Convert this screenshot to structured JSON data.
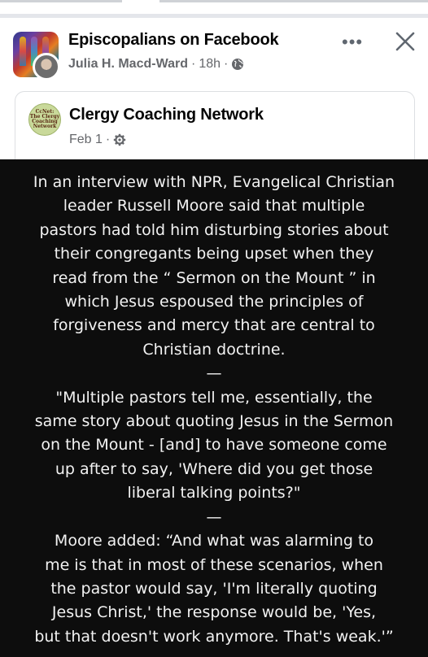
{
  "post": {
    "group_name": "Episcopalians on Facebook",
    "author": "Julia H. Macd-Ward",
    "separator": "·",
    "time": "18h",
    "more_glyph": "•••",
    "icons": {
      "visibility": "globe-icon",
      "more": "more-horizontal-icon",
      "close": "close-icon"
    }
  },
  "shared": {
    "page_name": "Clergy Coaching Network",
    "date": "Feb 1",
    "separator": "·",
    "avatar_text": "CcNet: The Clergy Coaching Network",
    "icons": {
      "audience": "gear-icon"
    }
  },
  "image": {
    "paragraph1": "In an interview with NPR, Evangelical Christian\nleader Russell Moore said that multiple\npastors had told him disturbing stories about\ntheir congregants being upset when they\nread from the “ Sermon on the Mount ” in\nwhich Jesus espoused the principles of\nforgiveness and mercy that are central to\nChristian doctrine.",
    "separator1": "—",
    "paragraph2": "\"Multiple pastors tell me, essentially, the\nsame story about quoting Jesus in the Sermon\non the Mount - [and] to have someone come\nup after to say, 'Where did you get those\nliberal talking points?\"",
    "separator2": "—",
    "paragraph3": "Moore added: “And what was alarming to\nme is that in most of these scenarios, when\nthe pastor would say, 'I'm literally quoting\nJesus Christ,' the response would be, 'Yes,\nbut that doesn't work anymore. That's weak.'”"
  },
  "colors": {
    "divider": "#e4e6eb",
    "meta_text": "#65676b",
    "image_bg": "#0d0d0d",
    "image_text": "#f2f2f2"
  }
}
